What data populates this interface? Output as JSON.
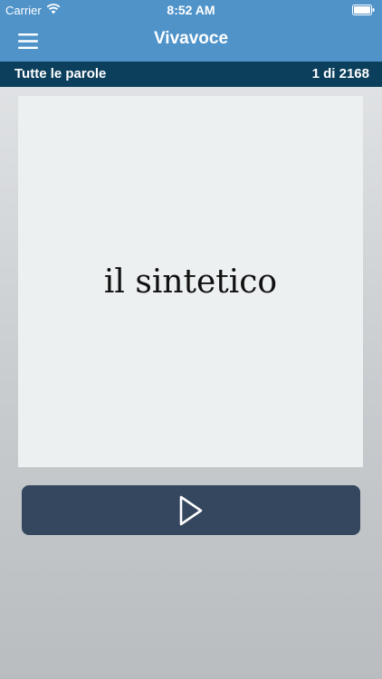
{
  "status_bar": {
    "carrier": "Carrier",
    "time": "8:52 AM",
    "icons": [
      "wifi-icon",
      "battery-icon"
    ]
  },
  "nav_bar": {
    "title": "Vivavoce",
    "menu_icon": "hamburger-menu-icon"
  },
  "sub_bar": {
    "category": "Tutte le parole",
    "counter": "1 di 2168"
  },
  "card": {
    "word": "il sintetico"
  },
  "play_button": {
    "icon": "play-icon"
  },
  "colors": {
    "nav_bar": "#4f93c9",
    "sub_bar": "#0c3f5c",
    "card": "#edf0f1",
    "play_button": "#34475e"
  }
}
